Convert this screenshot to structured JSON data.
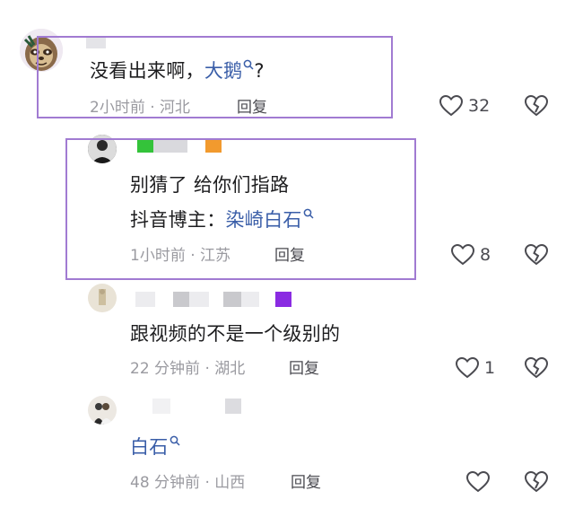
{
  "comments": [
    {
      "text": "没看出来啊，",
      "mention": "大鹅",
      "text_after": "?",
      "time": "2小时前",
      "location": "河北",
      "reply_label": "回复",
      "likes": "32"
    },
    {
      "line1": "别猜了 给你们指路",
      "line2_prefix": "抖音博主：",
      "mention": "染崎白石",
      "time": "1小时前",
      "location": "江苏",
      "reply_label": "回复",
      "likes": "8"
    },
    {
      "text": "跟视频的不是一个级别的",
      "time": "22 分钟前",
      "location": "湖北",
      "reply_label": "回复",
      "likes": "1"
    },
    {
      "mention": "白石",
      "time": "48 分钟前",
      "location": "山西",
      "reply_label": "回复",
      "likes": ""
    }
  ],
  "separator": "·",
  "colors": {
    "highlight_box": "#a17bd2",
    "mention_link": "#3a5ea8",
    "meta_gray": "#9a9aa0"
  },
  "icons": [
    "heart-icon",
    "broken-heart-icon",
    "search-icon"
  ]
}
